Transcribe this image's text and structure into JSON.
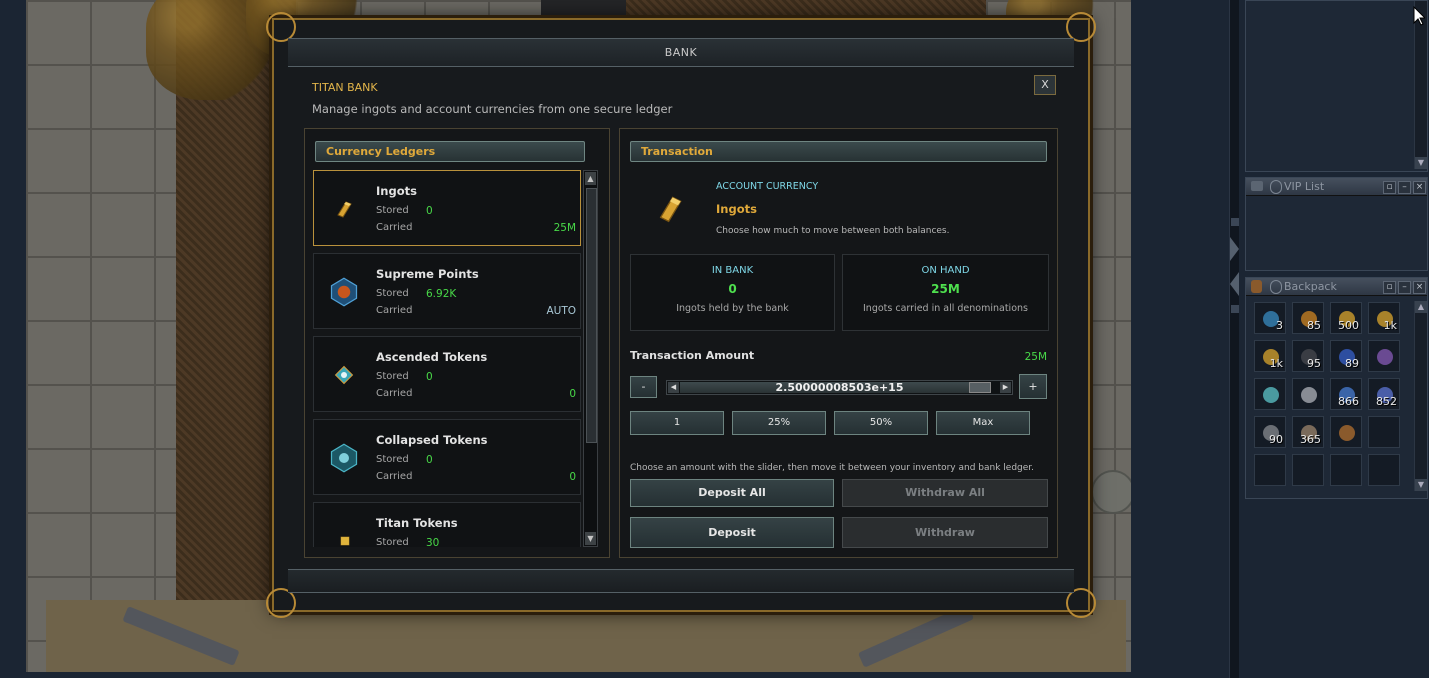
{
  "modal": {
    "title": "BANK",
    "close": "X",
    "bank_name": "TITAN BANK",
    "subtitle": "Manage ingots and account currencies from one secure ledger"
  },
  "ledgers": {
    "header": "Currency Ledgers",
    "stored_label": "Stored",
    "carried_label": "Carried",
    "items": [
      {
        "name": "Ingots",
        "stored": "0",
        "carried": "25M",
        "icon": "gold-ingot-icon"
      },
      {
        "name": "Supreme Points",
        "stored": "6.92K",
        "carried": "AUTO",
        "icon": "supreme-points-icon"
      },
      {
        "name": "Ascended Tokens",
        "stored": "0",
        "carried": "0",
        "icon": "ascended-token-icon"
      },
      {
        "name": "Collapsed Tokens",
        "stored": "0",
        "carried": "0",
        "icon": "collapsed-token-icon"
      },
      {
        "name": "Titan Tokens",
        "stored": "30",
        "icon": "titan-token-icon"
      }
    ]
  },
  "transaction": {
    "header": "Transaction",
    "currency_kind": "ACCOUNT CURRENCY",
    "currency_name": "Ingots",
    "currency_hint": "Choose how much to move between both balances.",
    "in_bank": {
      "title": "IN BANK",
      "value": "0",
      "desc": "Ingots held by the bank"
    },
    "on_hand": {
      "title": "ON HAND",
      "value": "25M",
      "desc": "Ingots carried in all denominations"
    },
    "amount_label": "Transaction Amount",
    "amount_max": "25M",
    "minus": "-",
    "plus": "+",
    "slider_value": "2.50000008503e+15",
    "slider_fraction": 0.97,
    "presets": [
      "1",
      "25%",
      "50%",
      "Max"
    ],
    "instructions": "Choose an amount with the slider, then move it between your inventory and bank ledger.",
    "deposit_all": "Deposit All",
    "withdraw_all": "Withdraw All",
    "deposit": "Deposit",
    "withdraw": "Withdraw"
  },
  "side": {
    "vip_title": "VIP List",
    "backpack_title": "Backpack",
    "backpack_counts": [
      "3",
      "85",
      "500",
      "1k",
      "1k",
      "95",
      "89",
      "",
      "",
      "",
      "866",
      "852",
      "90",
      "365",
      "",
      "",
      "",
      "",
      "",
      ""
    ]
  },
  "colors": {
    "accent_gold": "#e0a93a",
    "value_green": "#48d848",
    "info_cyan": "#7fd8e8",
    "frame_gold": "#8a6a2a"
  }
}
